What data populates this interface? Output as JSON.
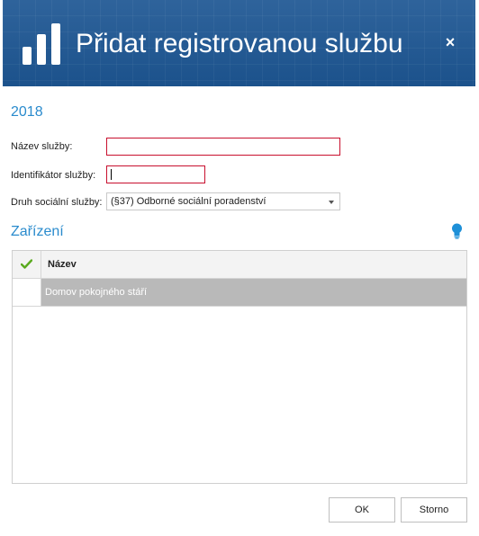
{
  "dialog": {
    "title": "Přidat registrovanou službu",
    "close_label": "×",
    "header_color": "#1d5693",
    "accent_color": "#2a8bcd",
    "error_border_color": "#c8102e"
  },
  "form": {
    "year": "2018",
    "service_name": {
      "label": "Název služby:",
      "value": ""
    },
    "service_id": {
      "label": "Identifikátor služby:",
      "value": ""
    },
    "social_service_type": {
      "label": "Druh sociální služby:",
      "selected": "(§37) Odborné sociální poradenství"
    }
  },
  "facilities": {
    "title": "Zařízení",
    "columns": {
      "check_icon": "checkmark-icon",
      "name": "Název"
    },
    "rows": [
      {
        "name": "Domov pokojného stáří",
        "checked": false,
        "selected": true
      }
    ]
  },
  "buttons": {
    "ok": "OK",
    "cancel": "Storno"
  }
}
